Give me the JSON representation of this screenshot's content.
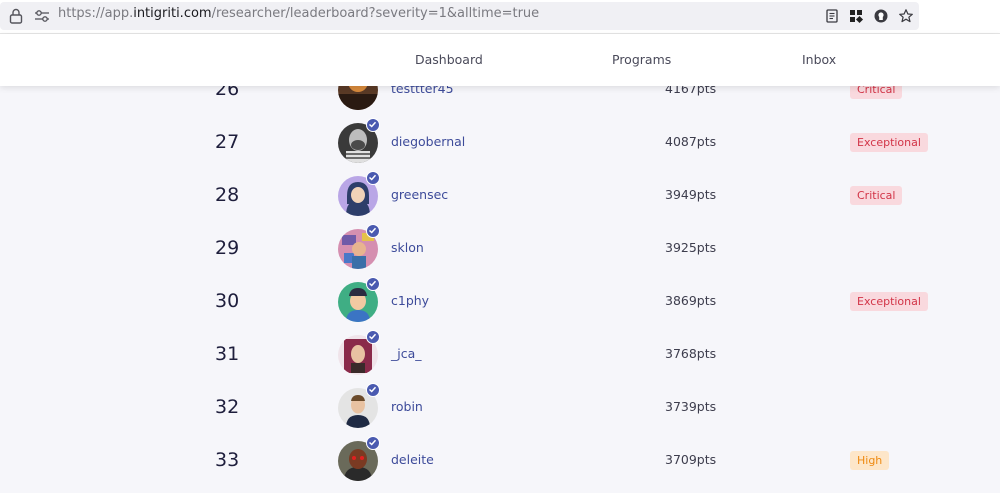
{
  "browser": {
    "url_prefix": "https://app.",
    "url_host": "intigriti.com",
    "url_path": "/researcher/leaderboard?severity=1&alltime=true",
    "icons": [
      "lock-icon",
      "site-settings-icon",
      "reader-mode-icon",
      "extensions-icon",
      "account-icon",
      "bookmark-star-icon"
    ]
  },
  "nav": {
    "dashboard": "Dashboard",
    "programs": "Programs",
    "inbox": "Inbox"
  },
  "colors": {
    "accent": "#3d4b9a",
    "critical_bg": "#f9d9de",
    "critical_fg": "#d23447",
    "high_bg": "#fde6c9",
    "high_fg": "#ee8a12"
  },
  "leaderboard": {
    "rows": [
      {
        "rank": "26",
        "username": "testtter45",
        "points": "4167pts",
        "badge": "Critical",
        "verified": false
      },
      {
        "rank": "27",
        "username": "diegobernal",
        "points": "4087pts",
        "badge": "Exceptional",
        "verified": true
      },
      {
        "rank": "28",
        "username": "greensec",
        "points": "3949pts",
        "badge": "Critical",
        "verified": true
      },
      {
        "rank": "29",
        "username": "sklon",
        "points": "3925pts",
        "badge": "",
        "verified": true
      },
      {
        "rank": "30",
        "username": "c1phy",
        "points": "3869pts",
        "badge": "Exceptional",
        "verified": true
      },
      {
        "rank": "31",
        "username": "_jca_",
        "points": "3768pts",
        "badge": "",
        "verified": true
      },
      {
        "rank": "32",
        "username": "robin",
        "points": "3739pts",
        "badge": "",
        "verified": true
      },
      {
        "rank": "33",
        "username": "deleite",
        "points": "3709pts",
        "badge": "High",
        "verified": true
      }
    ]
  }
}
